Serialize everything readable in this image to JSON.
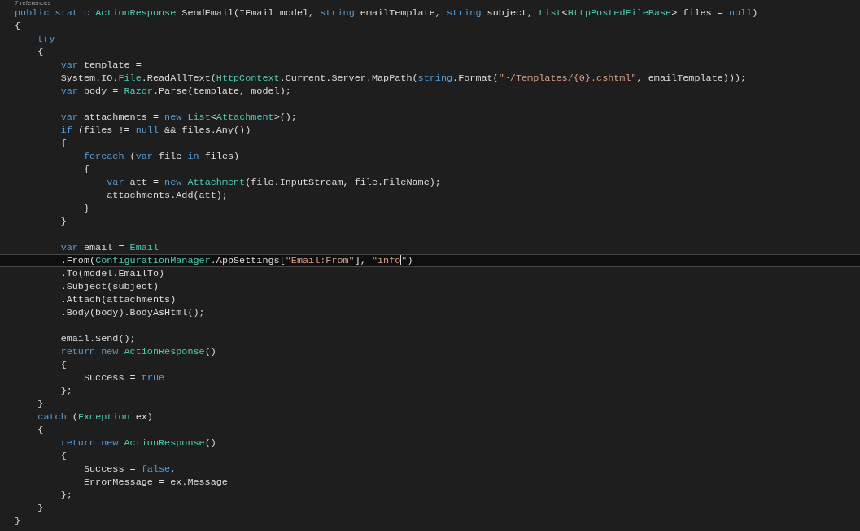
{
  "editor": {
    "lines": [
      {
        "kind": "codelens",
        "text": "7 references"
      },
      {
        "kind": "code",
        "current": false,
        "tokens": [
          {
            "kind": "keyword",
            "text": "public static "
          },
          {
            "kind": "type",
            "text": "ActionResponse"
          },
          {
            "kind": "plain",
            "text": " SendEmail(IEmail model, "
          },
          {
            "kind": "keyword",
            "text": "string"
          },
          {
            "kind": "plain",
            "text": " emailTemplate, "
          },
          {
            "kind": "keyword",
            "text": "string"
          },
          {
            "kind": "plain",
            "text": " subject, "
          },
          {
            "kind": "type",
            "text": "List"
          },
          {
            "kind": "plain",
            "text": "<"
          },
          {
            "kind": "type",
            "text": "HttpPostedFileBase"
          },
          {
            "kind": "plain",
            "text": "> files = "
          },
          {
            "kind": "keyword",
            "text": "null"
          },
          {
            "kind": "plain",
            "text": ")"
          }
        ]
      },
      {
        "kind": "code",
        "current": false,
        "tokens": [
          {
            "kind": "plain",
            "text": "{"
          }
        ]
      },
      {
        "kind": "code",
        "current": false,
        "tokens": [
          {
            "kind": "keyword",
            "text": "    try"
          }
        ]
      },
      {
        "kind": "code",
        "current": false,
        "tokens": [
          {
            "kind": "plain",
            "text": "    {"
          }
        ]
      },
      {
        "kind": "code",
        "current": false,
        "tokens": [
          {
            "kind": "keyword",
            "text": "        var"
          },
          {
            "kind": "plain",
            "text": " template ="
          }
        ]
      },
      {
        "kind": "code",
        "current": false,
        "tokens": [
          {
            "kind": "plain",
            "text": "        System.IO."
          },
          {
            "kind": "type",
            "text": "File"
          },
          {
            "kind": "plain",
            "text": ".ReadAllText("
          },
          {
            "kind": "type",
            "text": "HttpContext"
          },
          {
            "kind": "plain",
            "text": ".Current.Server.MapPath("
          },
          {
            "kind": "keyword",
            "text": "string"
          },
          {
            "kind": "plain",
            "text": ".Format("
          },
          {
            "kind": "string",
            "text": "\"~/Templates/{0}.cshtml\""
          },
          {
            "kind": "plain",
            "text": ", emailTemplate)));"
          }
        ]
      },
      {
        "kind": "code",
        "current": false,
        "tokens": [
          {
            "kind": "keyword",
            "text": "        var"
          },
          {
            "kind": "plain",
            "text": " body = "
          },
          {
            "kind": "type",
            "text": "Razor"
          },
          {
            "kind": "plain",
            "text": ".Parse(template, model);"
          }
        ]
      },
      {
        "kind": "blank",
        "current": false
      },
      {
        "kind": "code",
        "current": false,
        "tokens": [
          {
            "kind": "keyword",
            "text": "        var"
          },
          {
            "kind": "plain",
            "text": " attachments = "
          },
          {
            "kind": "keyword",
            "text": "new "
          },
          {
            "kind": "type",
            "text": "List"
          },
          {
            "kind": "plain",
            "text": "<"
          },
          {
            "kind": "type",
            "text": "Attachment"
          },
          {
            "kind": "plain",
            "text": ">();"
          }
        ]
      },
      {
        "kind": "code",
        "current": false,
        "tokens": [
          {
            "kind": "keyword",
            "text": "        if"
          },
          {
            "kind": "plain",
            "text": " (files != "
          },
          {
            "kind": "keyword",
            "text": "null"
          },
          {
            "kind": "plain",
            "text": " && files.Any())"
          }
        ]
      },
      {
        "kind": "code",
        "current": false,
        "tokens": [
          {
            "kind": "plain",
            "text": "        {"
          }
        ]
      },
      {
        "kind": "code",
        "current": false,
        "tokens": [
          {
            "kind": "keyword",
            "text": "            foreach"
          },
          {
            "kind": "plain",
            "text": " ("
          },
          {
            "kind": "keyword",
            "text": "var"
          },
          {
            "kind": "plain",
            "text": " file "
          },
          {
            "kind": "keyword",
            "text": "in"
          },
          {
            "kind": "plain",
            "text": " files)"
          }
        ]
      },
      {
        "kind": "code",
        "current": false,
        "tokens": [
          {
            "kind": "plain",
            "text": "            {"
          }
        ]
      },
      {
        "kind": "code",
        "current": false,
        "tokens": [
          {
            "kind": "keyword",
            "text": "                var"
          },
          {
            "kind": "plain",
            "text": " att = "
          },
          {
            "kind": "keyword",
            "text": "new "
          },
          {
            "kind": "type",
            "text": "Attachment"
          },
          {
            "kind": "plain",
            "text": "(file.InputStream, file.FileName);"
          }
        ]
      },
      {
        "kind": "code",
        "current": false,
        "tokens": [
          {
            "kind": "plain",
            "text": "                attachments.Add(att);"
          }
        ]
      },
      {
        "kind": "code",
        "current": false,
        "tokens": [
          {
            "kind": "plain",
            "text": "            }"
          }
        ]
      },
      {
        "kind": "code",
        "current": false,
        "tokens": [
          {
            "kind": "plain",
            "text": "        }"
          }
        ]
      },
      {
        "kind": "blank",
        "current": false
      },
      {
        "kind": "code",
        "current": false,
        "tokens": [
          {
            "kind": "keyword",
            "text": "        var"
          },
          {
            "kind": "plain",
            "text": " email = "
          },
          {
            "kind": "type",
            "text": "Email"
          }
        ]
      },
      {
        "kind": "code",
        "current": true,
        "tokens": [
          {
            "kind": "plain",
            "text": "        .From("
          },
          {
            "kind": "type",
            "text": "ConfigurationManager"
          },
          {
            "kind": "plain",
            "text": ".AppSettings["
          },
          {
            "kind": "string",
            "text": "\"Email:From\""
          },
          {
            "kind": "plain",
            "text": "], "
          },
          {
            "kind": "string",
            "text": "\"info"
          },
          {
            "kind": "caret"
          },
          {
            "kind": "string",
            "text": "\""
          },
          {
            "kind": "plain",
            "text": ")"
          }
        ]
      },
      {
        "kind": "code",
        "current": false,
        "tokens": [
          {
            "kind": "plain",
            "text": "        .To(model.EmailTo)"
          }
        ]
      },
      {
        "kind": "code",
        "current": false,
        "tokens": [
          {
            "kind": "plain",
            "text": "        .Subject(subject)"
          }
        ]
      },
      {
        "kind": "code",
        "current": false,
        "tokens": [
          {
            "kind": "plain",
            "text": "        .Attach(attachments)"
          }
        ]
      },
      {
        "kind": "code",
        "current": false,
        "tokens": [
          {
            "kind": "plain",
            "text": "        .Body(body).BodyAsHtml();"
          }
        ]
      },
      {
        "kind": "blank",
        "current": false
      },
      {
        "kind": "code",
        "current": false,
        "tokens": [
          {
            "kind": "plain",
            "text": "        email.Send();"
          }
        ]
      },
      {
        "kind": "code",
        "current": false,
        "tokens": [
          {
            "kind": "keyword",
            "text": "        return new "
          },
          {
            "kind": "type",
            "text": "ActionResponse"
          },
          {
            "kind": "plain",
            "text": "()"
          }
        ]
      },
      {
        "kind": "code",
        "current": false,
        "tokens": [
          {
            "kind": "plain",
            "text": "        {"
          }
        ]
      },
      {
        "kind": "code",
        "current": false,
        "tokens": [
          {
            "kind": "plain",
            "text": "            Success = "
          },
          {
            "kind": "keyword",
            "text": "true"
          }
        ]
      },
      {
        "kind": "code",
        "current": false,
        "tokens": [
          {
            "kind": "plain",
            "text": "        };"
          }
        ]
      },
      {
        "kind": "code",
        "current": false,
        "tokens": [
          {
            "kind": "plain",
            "text": "    }"
          }
        ]
      },
      {
        "kind": "code",
        "current": false,
        "tokens": [
          {
            "kind": "keyword",
            "text": "    catch"
          },
          {
            "kind": "plain",
            "text": " ("
          },
          {
            "kind": "type",
            "text": "Exception"
          },
          {
            "kind": "plain",
            "text": " ex)"
          }
        ]
      },
      {
        "kind": "code",
        "current": false,
        "tokens": [
          {
            "kind": "plain",
            "text": "    {"
          }
        ]
      },
      {
        "kind": "code",
        "current": false,
        "tokens": [
          {
            "kind": "keyword",
            "text": "        return new "
          },
          {
            "kind": "type",
            "text": "ActionResponse"
          },
          {
            "kind": "plain",
            "text": "()"
          }
        ]
      },
      {
        "kind": "code",
        "current": false,
        "tokens": [
          {
            "kind": "plain",
            "text": "        {"
          }
        ]
      },
      {
        "kind": "code",
        "current": false,
        "tokens": [
          {
            "kind": "plain",
            "text": "            Success = "
          },
          {
            "kind": "keyword",
            "text": "false"
          },
          {
            "kind": "plain",
            "text": ","
          }
        ]
      },
      {
        "kind": "code",
        "current": false,
        "tokens": [
          {
            "kind": "plain",
            "text": "            ErrorMessage = ex.Message"
          }
        ]
      },
      {
        "kind": "code",
        "current": false,
        "tokens": [
          {
            "kind": "plain",
            "text": "        };"
          }
        ]
      },
      {
        "kind": "code",
        "current": false,
        "tokens": [
          {
            "kind": "plain",
            "text": "    }"
          }
        ]
      },
      {
        "kind": "code",
        "current": false,
        "tokens": [
          {
            "kind": "plain",
            "text": "}"
          }
        ]
      }
    ]
  }
}
